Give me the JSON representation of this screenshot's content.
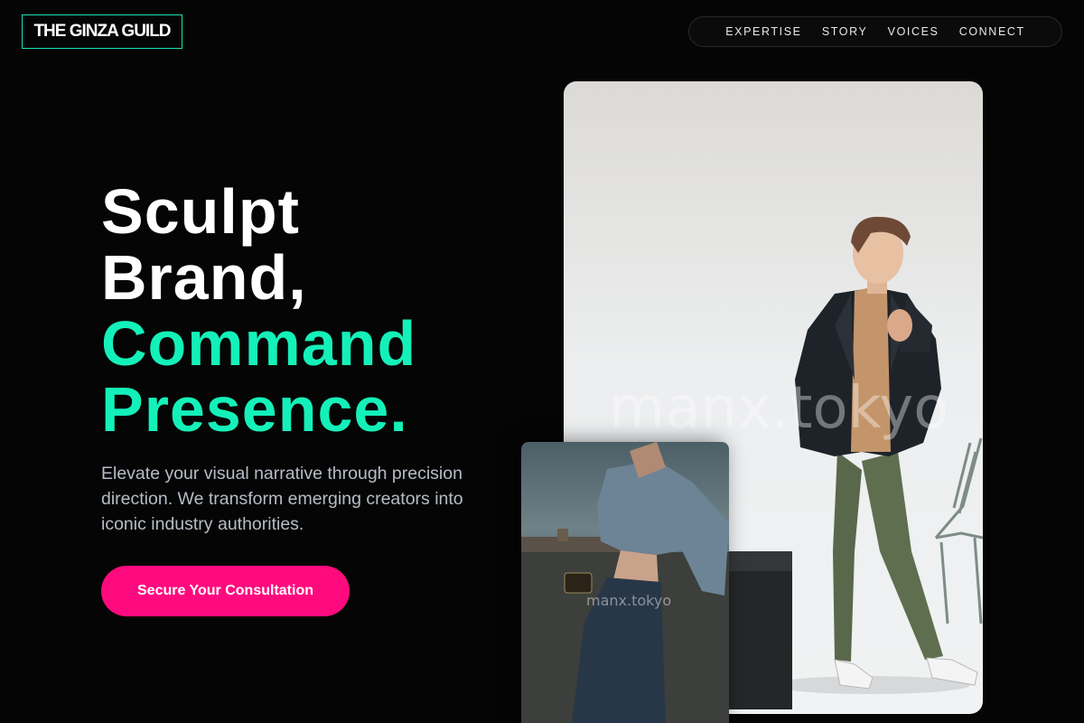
{
  "brand": {
    "logo_text": "THE GINZA GUILD",
    "accent_color": "#14f0b9"
  },
  "nav": {
    "items": [
      {
        "label": "EXPERTISE"
      },
      {
        "label": "STORY"
      },
      {
        "label": "VOICES"
      },
      {
        "label": "CONNECT"
      }
    ]
  },
  "hero": {
    "line1": "Sculpt",
    "line2": "Brand,",
    "line3": "Command",
    "line4": "Presence.",
    "subtext": "Elevate your visual narrative through precision direction. We transform emerging creators into iconic industry authorities.",
    "cta_label": "Secure Your Consultation",
    "cta_color": "#ff0a7e"
  },
  "images": {
    "main_watermark": "manx.tokyo",
    "small_watermark": "manx.tokyo"
  }
}
